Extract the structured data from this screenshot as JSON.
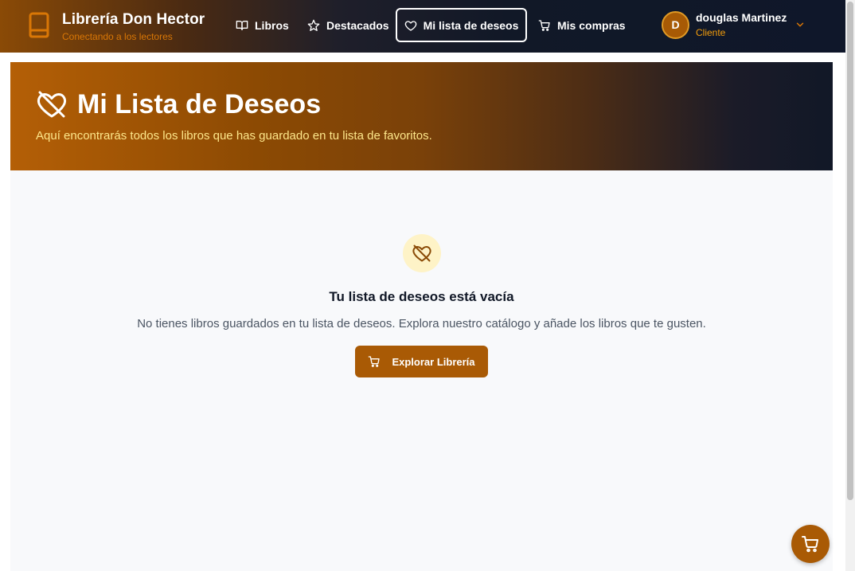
{
  "brand": {
    "title": "Librería Don Hector",
    "subtitle": "Conectando a los lectores",
    "icon": "book-icon"
  },
  "nav": {
    "items": [
      {
        "label": "Libros",
        "icon": "open-book-icon"
      },
      {
        "label": "Destacados",
        "icon": "star-icon"
      },
      {
        "label": "Mi lista de deseos",
        "icon": "heart-icon",
        "active": true
      },
      {
        "label": "Mis compras",
        "icon": "cart-icon"
      }
    ]
  },
  "user": {
    "initial": "D",
    "name": "douglas Martinez",
    "role": "Cliente"
  },
  "hero": {
    "title": "Mi Lista de Deseos",
    "subtitle": "Aquí encontrarás todos los libros que has guardado en tu lista de favoritos."
  },
  "empty": {
    "title": "Tu lista de deseos está vacía",
    "description": "No tienes libros guardados en tu lista de deseos. Explora nuestro catálogo y añade los libros que te gusten.",
    "button_label": "Explorar Librería"
  },
  "colors": {
    "accent": "#a95a05",
    "brand_orange": "#d97706",
    "dark_navy": "#111827"
  }
}
